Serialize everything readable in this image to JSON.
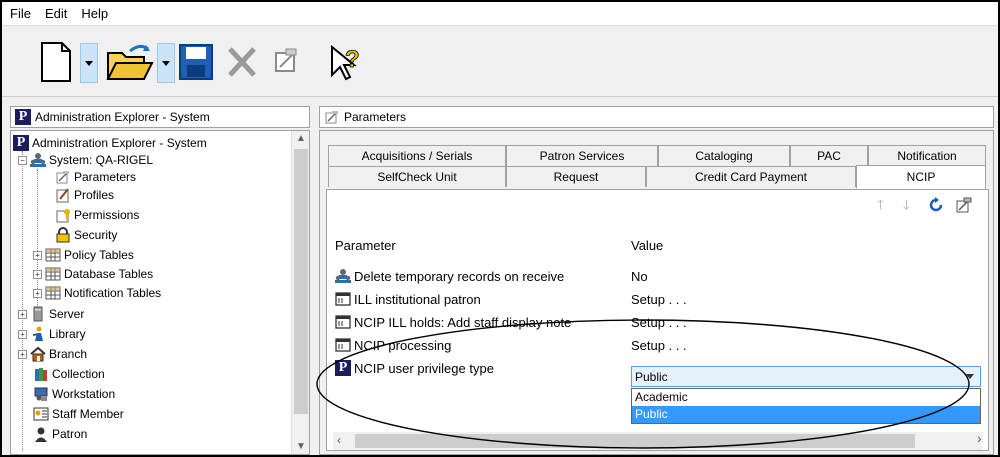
{
  "menu": {
    "items": [
      "File",
      "Edit",
      "Help"
    ]
  },
  "toolbar": {
    "icons": [
      "new-document-icon",
      "open-folder-icon",
      "save-icon",
      "delete-icon",
      "properties-icon",
      "help-icon"
    ]
  },
  "left_pane": {
    "header": "Administration Explorer - System"
  },
  "right_pane": {
    "header": "Parameters"
  },
  "tree": {
    "root": "Administration Explorer - System",
    "system": "System: QA-RIGEL",
    "children": [
      "Parameters",
      "Profiles",
      "Permissions",
      "Security",
      "Policy Tables",
      "Database Tables",
      "Notification Tables"
    ],
    "top_items": [
      "Server",
      "Library",
      "Branch",
      "Collection",
      "Workstation",
      "Staff Member",
      "Patron"
    ]
  },
  "tabs": {
    "row1": [
      "Acquisitions / Serials",
      "Patron Services",
      "Cataloging",
      "PAC",
      "Notification"
    ],
    "row2": [
      "SelfCheck Unit",
      "Request",
      "Credit Card Payment",
      "NCIP"
    ],
    "active": "NCIP"
  },
  "grid": {
    "header_param": "Parameter",
    "header_value": "Value",
    "rows": [
      {
        "param": "Delete temporary records on receive",
        "value": "No"
      },
      {
        "param": "ILL institutional patron",
        "value": "Setup . . ."
      },
      {
        "param": "NCIP ILL holds: Add staff display note",
        "value": "Setup . . ."
      },
      {
        "param": "NCIP processing",
        "value": "Setup . . ."
      },
      {
        "param": "NCIP user privilege type",
        "value": "Public"
      }
    ]
  },
  "dropdown": {
    "options": [
      "Academic",
      "Public"
    ],
    "selected": "Public"
  },
  "colors": {
    "selection": "#3399ff",
    "combo_bg": "#e5f1fb",
    "combo_border": "#569de5"
  }
}
